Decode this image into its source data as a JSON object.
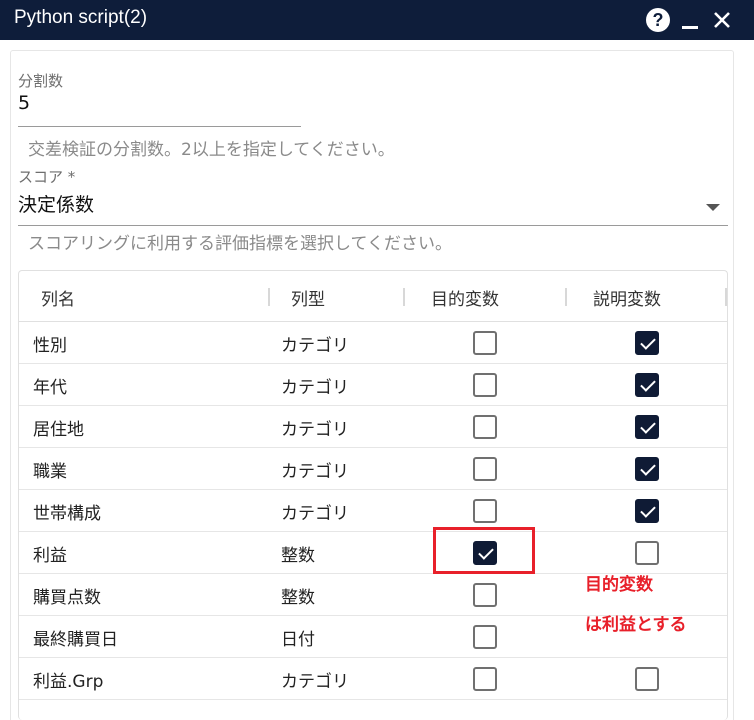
{
  "window": {
    "title": "Python script(2)"
  },
  "colors": {
    "titlebar": "#0e1d3a",
    "checkbox_checked": "#0f1b35",
    "annotation": "#e8202a"
  },
  "fields": {
    "splits": {
      "label": "分割数",
      "value": "5",
      "hint": "交差検証の分割数。2以上を指定してください。"
    },
    "score": {
      "label": "スコア *",
      "value": "決定係数",
      "hint": "スコアリングに利用する評価指標を選択してください。"
    }
  },
  "table": {
    "headers": [
      "列名",
      "列型",
      "目的変数",
      "説明変数"
    ],
    "rows": [
      {
        "name": "性別",
        "type": "カテゴリ",
        "target": false,
        "explanatory": true
      },
      {
        "name": "年代",
        "type": "カテゴリ",
        "target": false,
        "explanatory": true
      },
      {
        "name": "居住地",
        "type": "カテゴリ",
        "target": false,
        "explanatory": true
      },
      {
        "name": "職業",
        "type": "カテゴリ",
        "target": false,
        "explanatory": true
      },
      {
        "name": "世帯構成",
        "type": "カテゴリ",
        "target": false,
        "explanatory": true
      },
      {
        "name": "利益",
        "type": "整数",
        "target": true,
        "explanatory": false
      },
      {
        "name": "購買点数",
        "type": "整数",
        "target": false,
        "explanatory": null
      },
      {
        "name": "最終購買日",
        "type": "日付",
        "target": false,
        "explanatory": null
      },
      {
        "name": "利益.Grp",
        "type": "カテゴリ",
        "target": false,
        "explanatory": false
      }
    ]
  },
  "annotation": {
    "line1": "目的変数",
    "line2": "は利益とする"
  },
  "icons": {
    "help": "help-icon",
    "minimize": "minimize-icon",
    "close": "close-icon",
    "dropdown": "chevron-down-icon"
  }
}
